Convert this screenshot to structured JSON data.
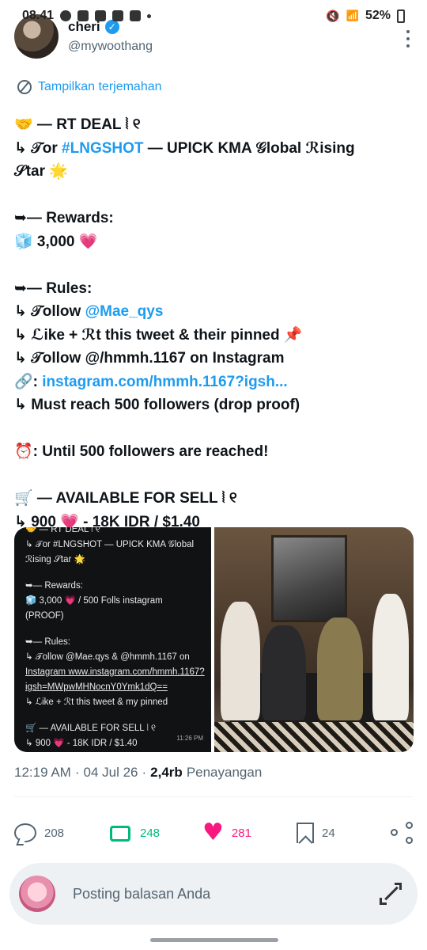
{
  "status_bar": {
    "time": "08.41",
    "battery": "52%"
  },
  "author": {
    "name": "cheri",
    "handle": "@mywoothang"
  },
  "translate_label": "Tampilkan terjemahan",
  "tweet": {
    "l1": "🤝 — RT DEAL ⦚ ୧",
    "l2a": "↳ 𝒯or ",
    "l2b": "#LNGSHOT",
    "l2c": " — UPICK KMA 𝒢lobal ℛising",
    "l3": "𝒮tar 🌟",
    "l4": "➥— Rewards:",
    "l5": "🧊 3,000 💗",
    "l6": "➥— Rules:",
    "l7a": "↳ 𝒯ollow ",
    "l7b": "@Mae_qys",
    "l8": "↳ ℒike + ℛt this tweet & their pinned 📌",
    "l9": "↳ 𝒯ollow @/hmmh.1167 on Instagram",
    "l10a": "🔗: ",
    "l10b": "instagram.com/hmmh.1167?igsh...",
    "l11": "↳ Must reach 500 followers (drop proof)",
    "l12": "⏰: Until 500 followers are reached!",
    "l13": "🛒 — AVAILABLE FOR SELL ⦚ ୧",
    "l14": "↳ 900 💗 - 18K IDR / $1.40"
  },
  "media_text": {
    "m1": "🤝 — RT DEAL ⦚ ୧",
    "m2": "↳ 𝒯or #LNGSHOT — UPICK KMA 𝒢lobal",
    "m3": "ℛising 𝒮tar 🌟",
    "m4": "➥— Rewards:",
    "m5": "🧊 3,000 💗 / 500 Folls instagram",
    "m6": "(PROOF)",
    "m7": "➥— Rules:",
    "m8": "↳ 𝒯ollow @Mae.qys & @hmmh.1167 on",
    "m9": "Instagram www.instagram.com/hmmh.1167?",
    "m10": "igsh=MWpwMHNocnY0Ymk1dQ==",
    "m11": "↳ ℒike + ℛt this tweet & my pinned",
    "m12": "🛒 — AVAILABLE FOR SELL ⦚ ୧",
    "m13": "↳ 900 💗 - 18K IDR / $1.40",
    "time": "11:26 PM"
  },
  "meta": {
    "time": "12:19 AM",
    "date": "04 Jul 26",
    "views": "2,4rb",
    "views_label": "Penayangan"
  },
  "actions": {
    "replies": "208",
    "retweets": "248",
    "likes": "281",
    "bookmarks": "24"
  },
  "reply_placeholder": "Posting balasan Anda"
}
